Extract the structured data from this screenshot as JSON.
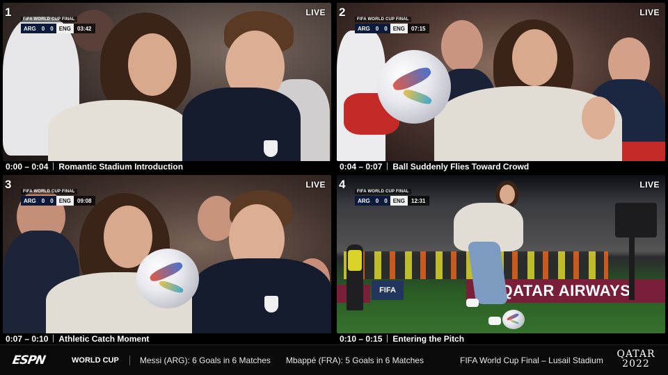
{
  "panels": [
    {
      "number": "1",
      "live": "LIVE",
      "scorebug": {
        "title": "FIFA WORLD CUP FINAL",
        "team1": "ARG",
        "score1": "0",
        "score2": "0",
        "team2": "ENG",
        "clock": "03:42"
      },
      "caption_time": "0:00 – 0:04",
      "caption_title": "Romantic Stadium Introduction"
    },
    {
      "number": "2",
      "live": "LIVE",
      "scorebug": {
        "title": "FIFA WORLD CUP FINAL",
        "team1": "ARG",
        "score1": "0",
        "score2": "0",
        "team2": "ENG",
        "clock": "07:15"
      },
      "caption_time": "0:04 – 0:07",
      "caption_title": "Ball Suddenly Flies Toward Crowd"
    },
    {
      "number": "3",
      "live": "LIVE",
      "scorebug": {
        "title": "FIFA WORLD CUP FINAL",
        "team1": "ARG",
        "score1": "0",
        "score2": "0",
        "team2": "ENG",
        "clock": "09:08"
      },
      "caption_time": "0:07 – 0:10",
      "caption_title": "Athletic Catch Moment"
    },
    {
      "number": "4",
      "live": "LIVE",
      "scorebug": {
        "title": "FIFA WORLD CUP FINAL",
        "team1": "ARG",
        "score1": "0",
        "score2": "0",
        "team2": "ENG",
        "clock": "12:31"
      },
      "caption_time": "0:10 – 0:15",
      "caption_title": "Entering the Pitch",
      "boards": {
        "left": "FIFA",
        "right": "QATAR AIRWAYS"
      }
    }
  ],
  "ticker": {
    "logo": "ESPN",
    "label": "WORLD CUP",
    "items": [
      "Messi (ARG): 6 Goals in 6 Matches",
      "Mbappé (FRA): 5 Goals in 6 Matches",
      "FIFA World Cup Final – Lusail Stadium"
    ],
    "event_logo_line1": "QATAR",
    "event_logo_line2": "2022"
  },
  "colors": {
    "scorebug_navy": "#0b1a3a",
    "ad_board_maroon": "#7a1f3a",
    "pitch_green": "#35722c"
  }
}
